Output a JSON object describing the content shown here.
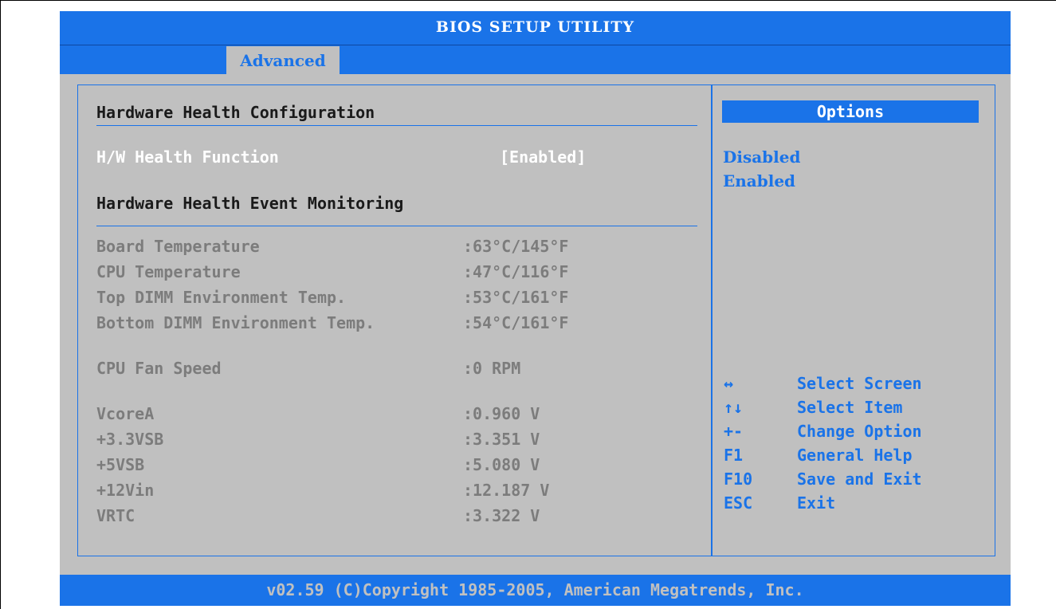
{
  "window": {
    "title": "BIOS SETUP UTILITY"
  },
  "menu": {
    "active_tab": "Advanced"
  },
  "main": {
    "section_title": "Hardware Health Configuration",
    "setting": {
      "label": "H/W Health Function",
      "value": "[Enabled]"
    },
    "monitoring_title": "Hardware Health Event Monitoring",
    "readings": [
      {
        "label": "Board Temperature",
        "value": ":63°C/145°F"
      },
      {
        "label": "CPU Temperature",
        "value": ":47°C/116°F"
      },
      {
        "label": "Top DIMM Environment Temp.",
        "value": ":53°C/161°F"
      },
      {
        "label": "Bottom DIMM Environment Temp.",
        "value": ":54°C/161°F"
      },
      {
        "label": "CPU Fan Speed",
        "value": ":0 RPM"
      },
      {
        "label": "VcoreA",
        "value": ":0.960 V"
      },
      {
        "label": "+3.3VSB",
        "value": ":3.351 V"
      },
      {
        "label": "+5VSB",
        "value": ":5.080 V"
      },
      {
        "label": "+12Vin",
        "value": ":12.187 V"
      },
      {
        "label": "VRTC",
        "value": ":3.322 V"
      }
    ]
  },
  "side": {
    "options_title": "Options",
    "options": [
      "Disabled",
      "Enabled"
    ],
    "help": [
      {
        "key": "↔",
        "desc": "Select Screen"
      },
      {
        "key": "↑↓",
        "desc": "Select Item"
      },
      {
        "key": "+-",
        "desc": "Change Option"
      },
      {
        "key": "F1",
        "desc": "General Help"
      },
      {
        "key": "F10",
        "desc": "Save and Exit"
      },
      {
        "key": "ESC",
        "desc": "Exit"
      }
    ]
  },
  "footer": {
    "copyright": "v02.59 (C)Copyright 1985-2005, American Megatrends, Inc."
  },
  "colors": {
    "accent": "#1a73e8",
    "background": "#c0c0c0",
    "dim_text": "#7c7c7c",
    "highlight_text": "#ffffff"
  }
}
